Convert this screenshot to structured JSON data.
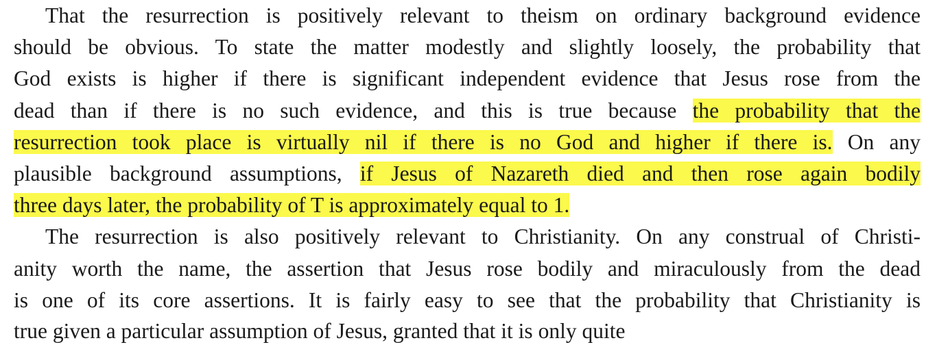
{
  "paragraph1": {
    "line1": "That the resurrection is positively relevant to theism on ordinary background evidence",
    "line2": "should be obvious. To state the matter modestly and slightly loosely, the probability that",
    "line3": "God exists is higher if there is significant independent evidence that Jesus rose from the",
    "line4_plain": "dead than if there is no such evidence, and this is true because ",
    "line4_highlight": "the probability that the",
    "line5_highlight": "resurrection took place is virtually nil if there is no God and higher if there is.",
    "line5_plain": " On any",
    "line6_plain": "plausible background assumptions, ",
    "line6_highlight": "if Jesus of Nazareth died and then rose again bodily",
    "line7_highlight": "three days later, the probability of T is approximately equal to 1."
  },
  "paragraph2": {
    "line1": "The resurrection is also positively relevant to Christianity. On any construal of Christi-",
    "line2": "anity worth the name, the assertion that Jesus rose bodily and miraculously from the dead",
    "line3": "is one of its core assertions. It is fairly easy to see that the probability that Christianity is",
    "line4_partial": "true given a particular assumption of Jesus, granted that it is only quite"
  },
  "colors": {
    "highlight": "#fbf94b",
    "text": "#1a1a1a",
    "background": "#ffffff"
  }
}
